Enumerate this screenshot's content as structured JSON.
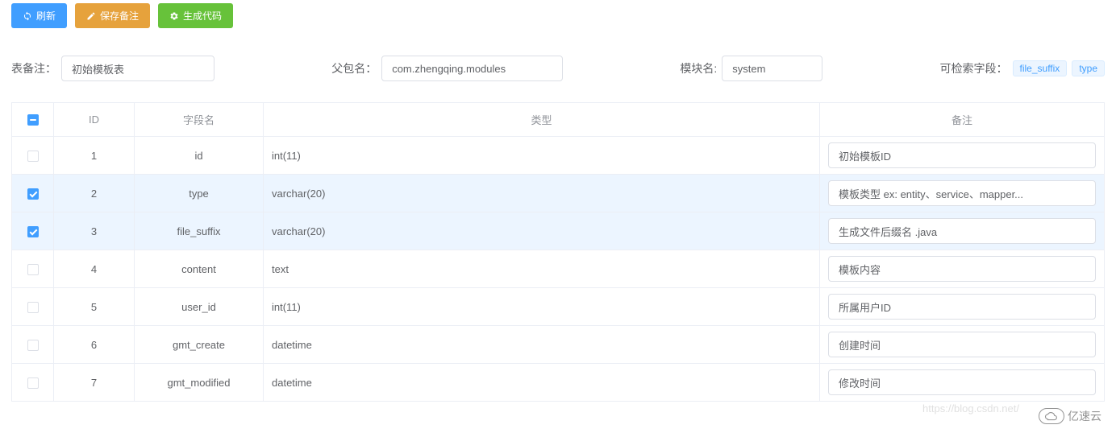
{
  "toolbar": {
    "refresh": "刷新",
    "saveRemark": "保存备注",
    "generate": "生成代码"
  },
  "form": {
    "tableRemarkLabel": "表备注：",
    "tableRemarkValue": "初始模板表",
    "parentPkgLabel": "父包名：",
    "parentPkgValue": "com.zhengqing.modules",
    "moduleLabel": "模块名:",
    "moduleValue": "system",
    "searchableLabel": "可检索字段：",
    "tags": [
      "file_suffix",
      "type"
    ]
  },
  "table": {
    "headers": {
      "id": "ID",
      "field": "字段名",
      "type": "类型",
      "remark": "备注"
    },
    "rows": [
      {
        "checked": false,
        "id": "1",
        "field": "id",
        "type": "int(11)",
        "remark": "初始模板ID"
      },
      {
        "checked": true,
        "id": "2",
        "field": "type",
        "type": "varchar(20)",
        "remark": "模板类型 ex: entity、service、mapper..."
      },
      {
        "checked": true,
        "id": "3",
        "field": "file_suffix",
        "type": "varchar(20)",
        "remark": "生成文件后缀名 .java"
      },
      {
        "checked": false,
        "id": "4",
        "field": "content",
        "type": "text",
        "remark": "模板内容"
      },
      {
        "checked": false,
        "id": "5",
        "field": "user_id",
        "type": "int(11)",
        "remark": "所属用户ID"
      },
      {
        "checked": false,
        "id": "6",
        "field": "gmt_create",
        "type": "datetime",
        "remark": "创建时间"
      },
      {
        "checked": false,
        "id": "7",
        "field": "gmt_modified",
        "type": "datetime",
        "remark": "修改时间"
      }
    ]
  },
  "watermark": "https://blog.csdn.net/",
  "brand": "亿速云"
}
